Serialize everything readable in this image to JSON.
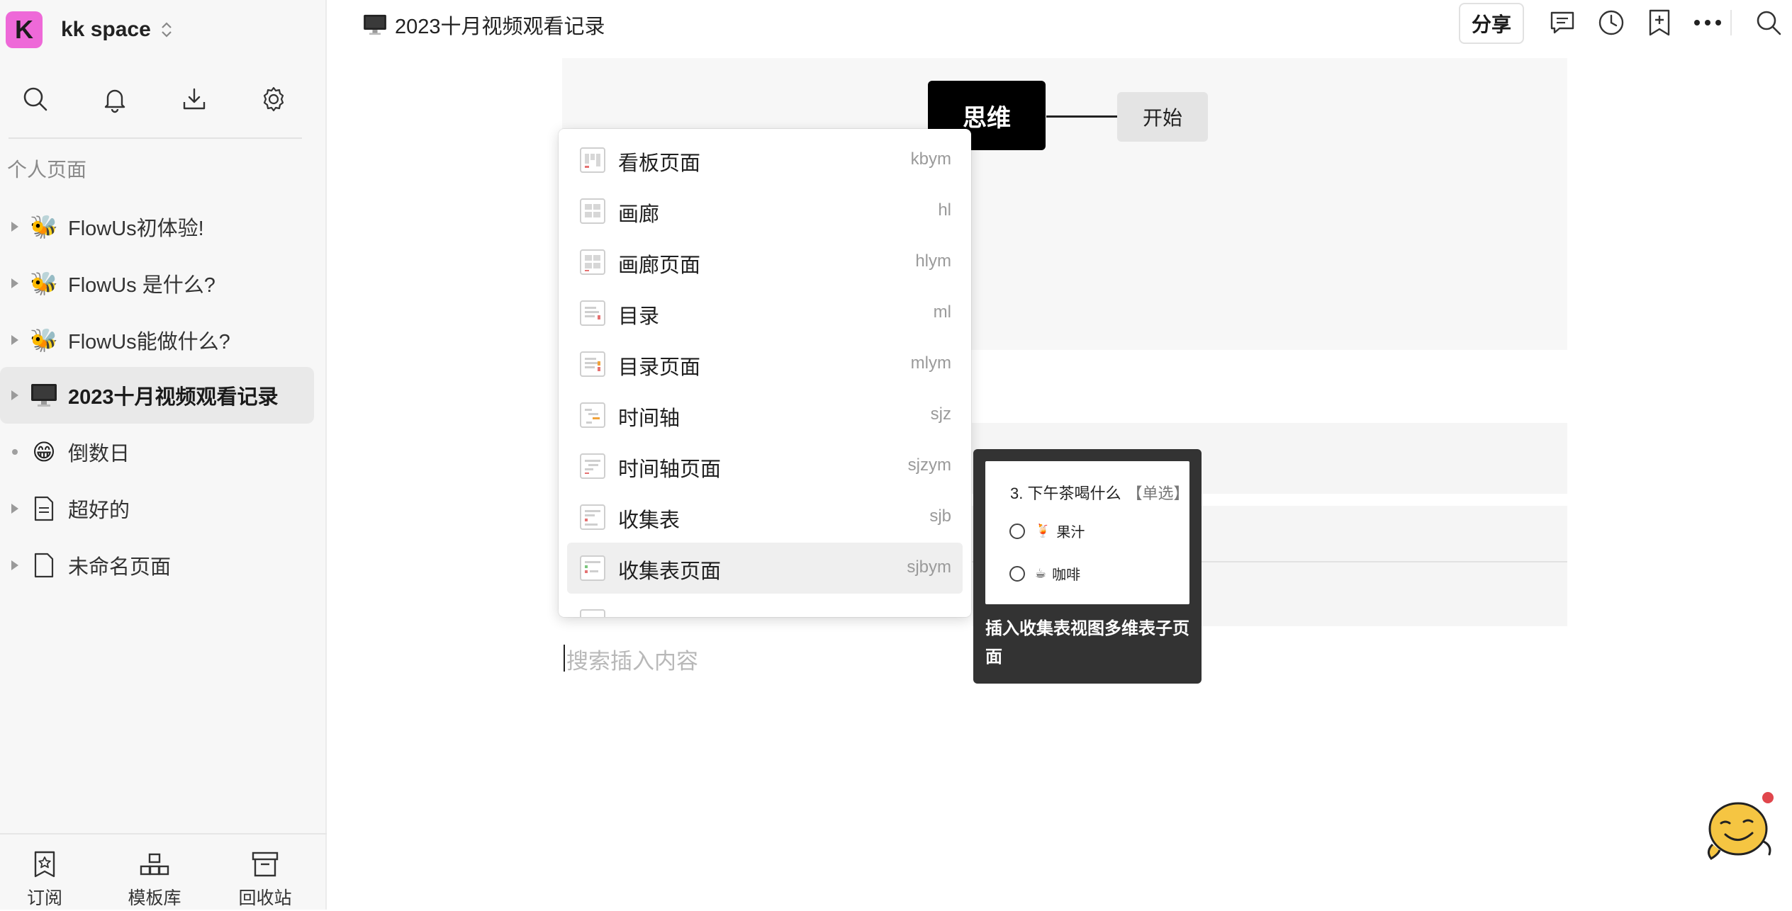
{
  "workspace": {
    "avatar_letter": "K",
    "name": "kk space",
    "avatar_color": "#ee69d8"
  },
  "sidebar": {
    "tools": [
      {
        "name": "search-icon"
      },
      {
        "name": "bell-icon"
      },
      {
        "name": "download-icon"
      },
      {
        "name": "gear-icon"
      }
    ],
    "section_title": "个人页面",
    "items": [
      {
        "label": "FlowUs初体验!",
        "icon": "bee-icon",
        "glyph": "🐝",
        "marker": "arrow"
      },
      {
        "label": "FlowUs 是什么?",
        "icon": "bee-icon",
        "glyph": "🐝",
        "marker": "arrow"
      },
      {
        "label": "FlowUs能做什么?",
        "icon": "bee-icon",
        "glyph": "🐝",
        "marker": "arrow"
      },
      {
        "label": "2023十月视频观看记录",
        "icon": "monitor-icon",
        "glyph": "🖥",
        "marker": "arrow",
        "active": true
      },
      {
        "label": "倒数日",
        "icon": "grin-icon",
        "glyph": "😁",
        "marker": "dot"
      },
      {
        "label": "超好的",
        "icon": "document-icon",
        "glyph": "",
        "marker": "arrow"
      },
      {
        "label": "未命名页面",
        "icon": "blank-page-icon",
        "glyph": "",
        "marker": "arrow"
      }
    ],
    "bottom": [
      {
        "label": "订阅",
        "icon": "subscribe-icon"
      },
      {
        "label": "模板库",
        "icon": "template-icon"
      },
      {
        "label": "回收站",
        "icon": "trash-icon"
      }
    ]
  },
  "topbar": {
    "title": "2023十月视频观看记录",
    "title_icon": "monitor-icon",
    "share_label": "分享",
    "icons": [
      "comment-icon",
      "history-icon",
      "bookmark-add-icon",
      "more-icon",
      "search-icon"
    ]
  },
  "mindmap": {
    "main_node": "思维",
    "child_node": "开始"
  },
  "editor": {
    "placeholder": "搜索插入内容"
  },
  "dropdown": {
    "items": [
      {
        "label": "看板页面",
        "shortcut": "kbym",
        "icon": "kanban-page-icon"
      },
      {
        "label": "画廊",
        "shortcut": "hl",
        "icon": "gallery-icon"
      },
      {
        "label": "画廊页面",
        "shortcut": "hlym",
        "icon": "gallery-page-icon"
      },
      {
        "label": "目录",
        "shortcut": "ml",
        "icon": "toc-icon"
      },
      {
        "label": "目录页面",
        "shortcut": "mlym",
        "icon": "toc-page-icon"
      },
      {
        "label": "时间轴",
        "shortcut": "sjz",
        "icon": "timeline-icon"
      },
      {
        "label": "时间轴页面",
        "shortcut": "sjzym",
        "icon": "timeline-page-icon"
      },
      {
        "label": "收集表",
        "shortcut": "sjb",
        "icon": "form-icon"
      },
      {
        "label": "收集表页面",
        "shortcut": "sjbym",
        "icon": "form-page-icon",
        "highlighted": true
      }
    ]
  },
  "preview": {
    "question": "3. 下午茶喝什么",
    "tag": "【单选】",
    "options": [
      {
        "emoji": "🍹",
        "label": "果汁"
      },
      {
        "emoji": "☕",
        "label": "咖啡"
      }
    ],
    "description": "插入收集表视图多维表子页面"
  },
  "colors": {
    "accent": "#ee69d8",
    "mascot": "#f5c542",
    "notification_dot": "#e0464c"
  }
}
